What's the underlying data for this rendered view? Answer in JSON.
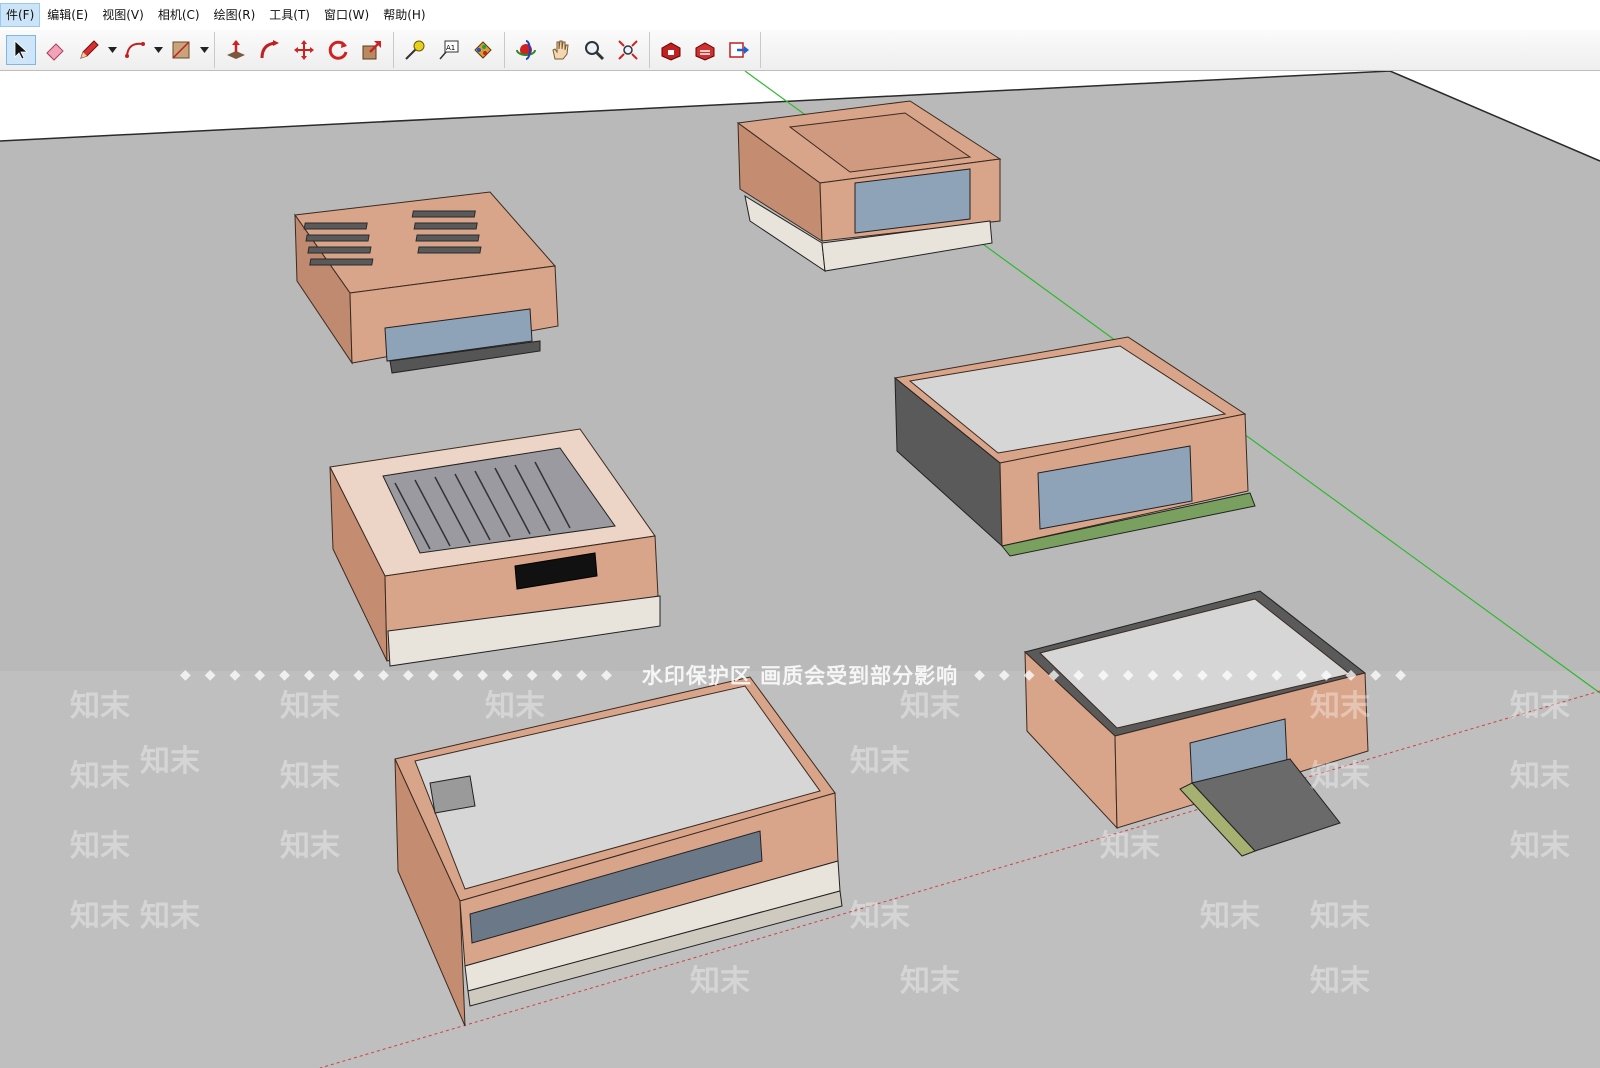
{
  "menu": {
    "items": [
      {
        "label": "件(F)"
      },
      {
        "label": "编辑(E)"
      },
      {
        "label": "视图(V)"
      },
      {
        "label": "相机(C)"
      },
      {
        "label": "绘图(R)"
      },
      {
        "label": "工具(T)"
      },
      {
        "label": "窗口(W)"
      },
      {
        "label": "帮助(H)"
      }
    ]
  },
  "toolbar": {
    "tools": [
      {
        "name": "select-icon"
      },
      {
        "name": "eraser-icon"
      },
      {
        "name": "pencil-icon"
      },
      {
        "name": "arc-icon"
      },
      {
        "name": "rectangle-icon"
      },
      {
        "name": "push-pull-icon"
      },
      {
        "name": "follow-me-icon"
      },
      {
        "name": "move-icon"
      },
      {
        "name": "rotate-icon"
      },
      {
        "name": "scale-icon"
      },
      {
        "name": "tape-measure-icon"
      },
      {
        "name": "text-icon"
      },
      {
        "name": "paint-bucket-icon"
      },
      {
        "name": "orbit-icon"
      },
      {
        "name": "pan-icon"
      },
      {
        "name": "zoom-icon"
      },
      {
        "name": "zoom-extents-icon"
      },
      {
        "name": "warehouse-icon"
      },
      {
        "name": "extension-warehouse-icon"
      },
      {
        "name": "send-to-layout-icon"
      }
    ]
  },
  "viewport": {
    "watermark_text": "水印保护区  画质会受到部分影响",
    "tiles": [
      "知末",
      "知末",
      "知末",
      "知末",
      "知末",
      "知末",
      "知末",
      "知末",
      "知末",
      "知末",
      "知末",
      "知末",
      "知末",
      "知末",
      "知末",
      "知末",
      "知末",
      "知末",
      "知末",
      "知末",
      "知末",
      "知末",
      "知末",
      "知末"
    ],
    "colors": {
      "ground": "#b8b8b8",
      "facade": "#dba68a",
      "roof": "#dcdcdc",
      "glass": "#8fa3b8",
      "axis_green": "#2fb82f",
      "axis_red": "#d04040"
    }
  }
}
